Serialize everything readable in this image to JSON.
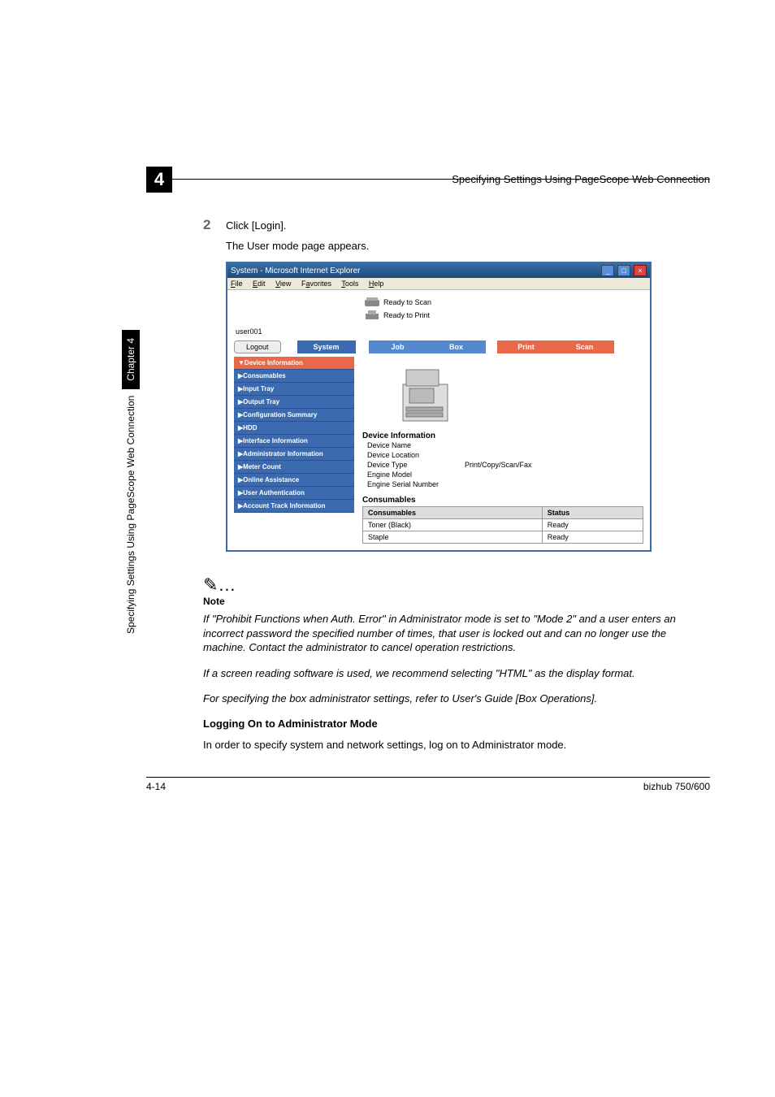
{
  "header": {
    "chapter_number": "4",
    "running_title": "Specifying Settings Using PageScope Web Connection"
  },
  "side": {
    "text": "Specifying Settings Using PageScope Web Connection",
    "chapter": "Chapter 4"
  },
  "step": {
    "number": "2",
    "text": "Click [Login].",
    "sub": "The User mode page appears."
  },
  "browser": {
    "title": "System - Microsoft Internet Explorer",
    "menu": {
      "file": "File",
      "edit": "Edit",
      "view": "View",
      "favorites": "Favorites",
      "tools": "Tools",
      "help": "Help"
    },
    "status_scan": "Ready to Scan",
    "status_print": "Ready to Print",
    "user": "user001",
    "logout": "Logout",
    "tabs": {
      "system": "System",
      "job": "Job",
      "box": "Box",
      "print": "Print",
      "scan": "Scan"
    },
    "sidebar": [
      "▼Device Information",
      "▶Consumables",
      "▶Input Tray",
      "▶Output Tray",
      "▶Configuration Summary",
      "▶HDD",
      "▶Interface Information",
      "▶Administrator Information",
      "▶Meter Count",
      "▶Online Assistance",
      "▶User Authentication",
      "▶Account Track Information"
    ],
    "sect1": "Device Information",
    "info": {
      "name": "Device Name",
      "loc": "Device Location",
      "type_l": "Device Type",
      "type_v": "Print/Copy/Scan/Fax",
      "model": "Engine Model",
      "serial": "Engine Serial Number"
    },
    "sect2": "Consumables",
    "th1": "Consumables",
    "th2": "Status",
    "r1c1": "Toner (Black)",
    "r1c2": "Ready",
    "r2c1": "Staple",
    "r2c2": "Ready"
  },
  "note": {
    "icon": "✎…",
    "title": "Note",
    "p1": "If \"Prohibit Functions when Auth. Error\" in Administrator mode is set to \"Mode 2\" and a user enters an incorrect password the specified number of times, that user is locked out and can no longer use the machine. Contact the administrator to cancel operation restrictions.",
    "p2": "If a screen reading software is used, we recommend selecting \"HTML\" as the display format.",
    "p3": "For specifying the box administrator settings, refer to User's Guide [Box Operations]."
  },
  "subhead": "Logging On to Administrator Mode",
  "body": "In order to specify system and network settings, log on to Administrator mode.",
  "footer": {
    "left": "4-14",
    "right": "bizhub 750/600"
  }
}
